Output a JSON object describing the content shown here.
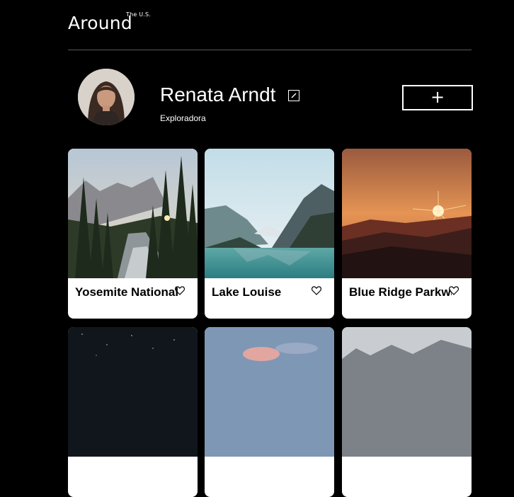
{
  "header": {
    "logo": "Around",
    "logo_sup": "The U.S."
  },
  "profile": {
    "name": "Renata Arndt",
    "description": "Exploradora",
    "add_label": "+"
  },
  "cards": [
    {
      "title": "Yosemite National Park",
      "like_icon": "heart-icon"
    },
    {
      "title": "Lake Louise",
      "like_icon": "heart-icon"
    },
    {
      "title": "Blue Ridge Parkway",
      "like_icon": "heart-icon"
    }
  ]
}
